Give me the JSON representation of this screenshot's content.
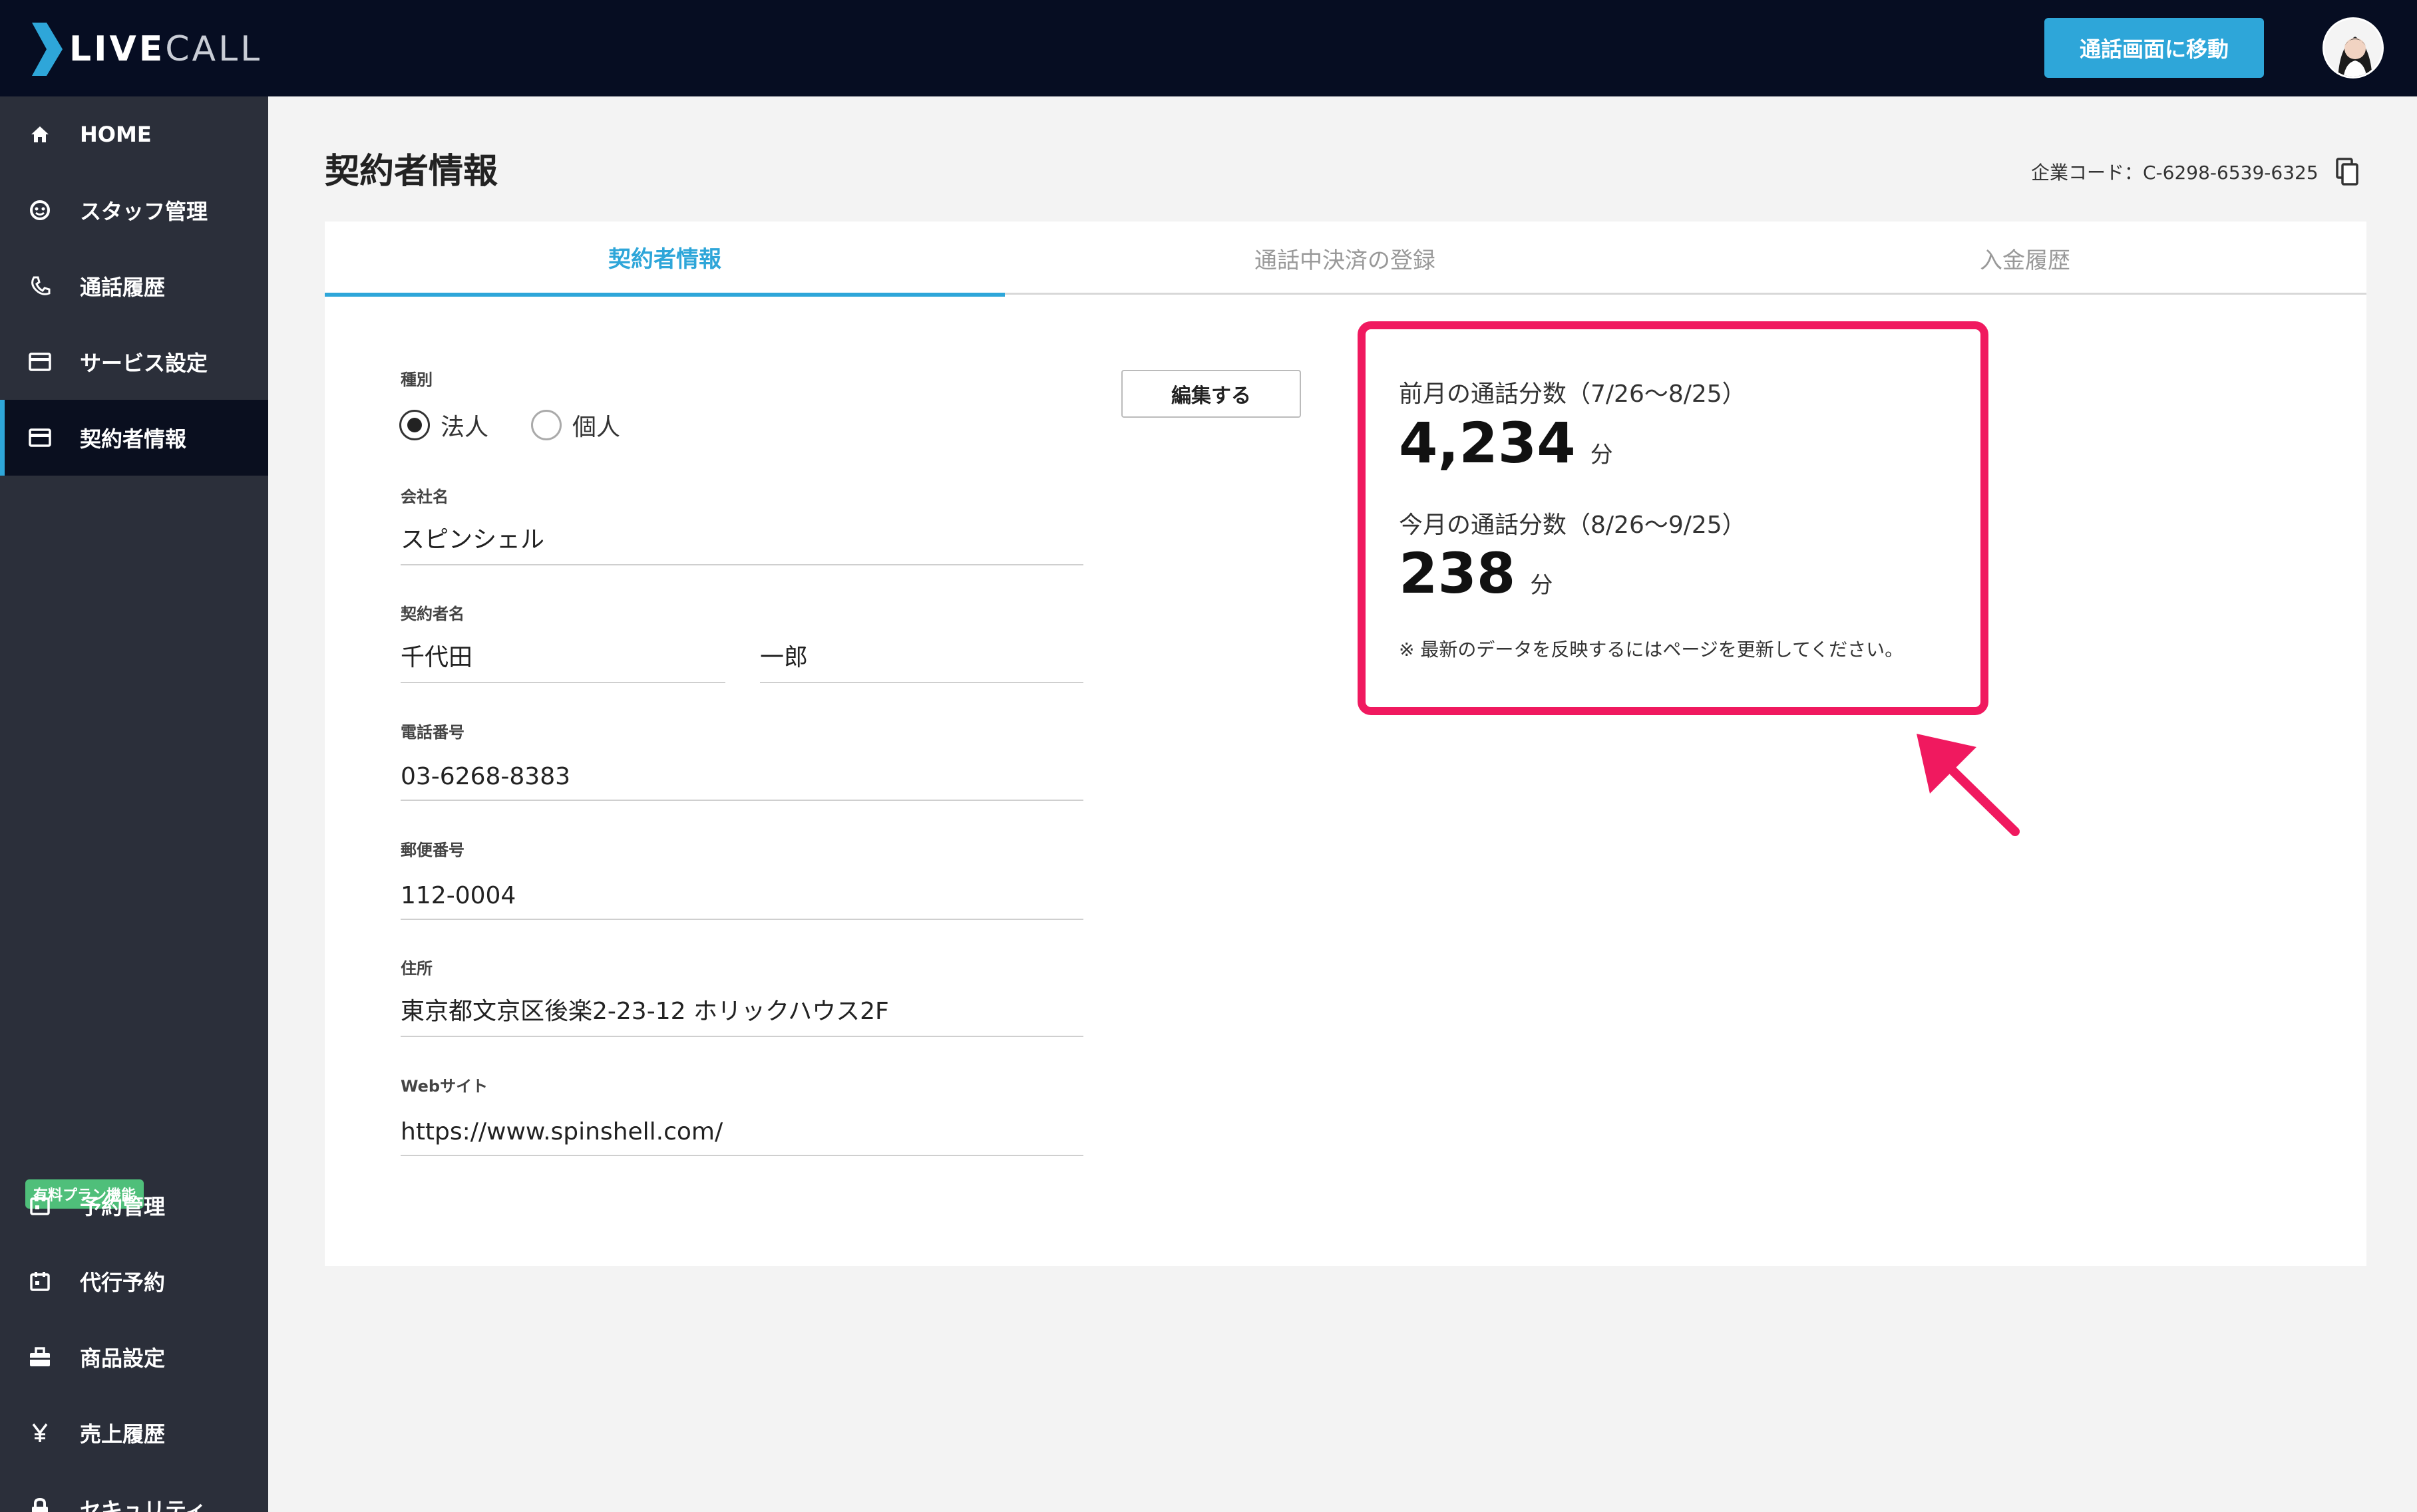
{
  "app": {
    "logo_text_bold": "LIVE",
    "logo_text_light": "CALL"
  },
  "header": {
    "action_button": "通話画面に移動"
  },
  "sidebar": {
    "items": [
      {
        "label": "HOME",
        "icon": "home-icon"
      },
      {
        "label": "スタッフ管理",
        "icon": "staff-icon"
      },
      {
        "label": "通話履歴",
        "icon": "phone-icon"
      },
      {
        "label": "サービス設定",
        "icon": "card-icon"
      },
      {
        "label": "契約者情報",
        "icon": "card-icon",
        "active": true
      }
    ],
    "paid_badge": "有料プラン機能",
    "paid_items": [
      {
        "label": "予約管理",
        "icon": "calendar-icon"
      },
      {
        "label": "代行予約",
        "icon": "calendar-icon"
      },
      {
        "label": "商品設定",
        "icon": "gift-icon"
      },
      {
        "label": "売上履歴",
        "icon": "yen-icon"
      },
      {
        "label": "セキュリティ",
        "icon": "lock-icon"
      }
    ]
  },
  "page": {
    "title": "契約者情報",
    "company_code": "企業コード：C-6298-6539-6325"
  },
  "tabs": [
    {
      "label": "契約者情報",
      "active": true
    },
    {
      "label": "通話中決済の登録"
    },
    {
      "label": "入金履歴"
    }
  ],
  "form": {
    "type_label": "種別",
    "type_options": [
      "法人",
      "個人"
    ],
    "type_selected": "法人",
    "company_label": "会社名",
    "company_value": "スピンシェル",
    "contractor_label": "契約者名",
    "last_name": "千代田",
    "first_name": "一郎",
    "phone_label": "電話番号",
    "phone_value": "03-6268-8383",
    "postal_label": "郵便番号",
    "postal_value": "112-0004",
    "address_label": "住所",
    "address_value": "東京都文京区後楽2-23-12 ホリックハウス2F",
    "website_label": "Webサイト",
    "website_value": "https://www.spinshell.com/",
    "edit_button": "編集する"
  },
  "usage": {
    "prev_label": "前月の通話分数（7/26〜8/25）",
    "prev_value": "4,234",
    "curr_label": "今月の通話分数（8/26〜9/25）",
    "curr_value": "238",
    "unit": "分",
    "note": "※ 最新のデータを反映するにはページを更新してください。"
  },
  "colors": {
    "accent": "#2ea6d9",
    "highlight": "#f0195f",
    "sidebar": "#2b2f3a",
    "topbar": "#060d22",
    "paid_badge": "#4fbf7a"
  }
}
